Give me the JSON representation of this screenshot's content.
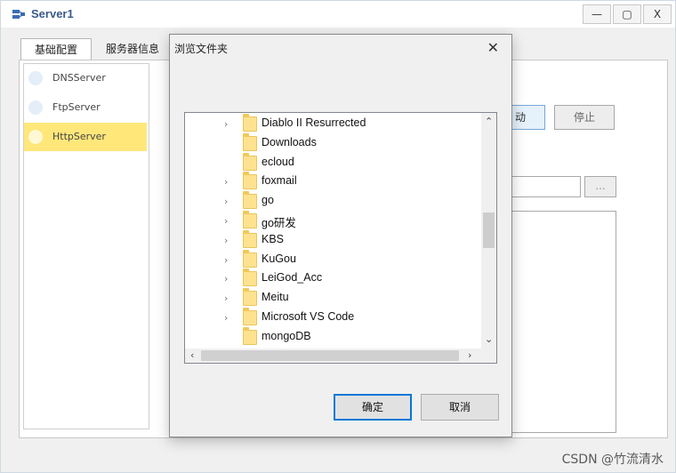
{
  "app": {
    "title": "Server1",
    "minimize": "—",
    "maximize": "▢",
    "close": "X"
  },
  "tabs": [
    "基础配置",
    "服务器信息"
  ],
  "services": [
    "DNSServer",
    "FtpServer",
    "HttpServer"
  ],
  "background_buttons": {
    "start_partial": "动",
    "stop": "停止",
    "browse": "..."
  },
  "dialog": {
    "title": "浏览文件夹",
    "close": "✕",
    "folders": [
      {
        "name": "Diablo II Resurrected",
        "expandable": true
      },
      {
        "name": "Downloads",
        "expandable": false
      },
      {
        "name": "ecloud",
        "expandable": false
      },
      {
        "name": "foxmail",
        "expandable": true
      },
      {
        "name": "go",
        "expandable": true
      },
      {
        "name": "go研发",
        "expandable": true
      },
      {
        "name": "KBS",
        "expandable": true
      },
      {
        "name": "KuGou",
        "expandable": true
      },
      {
        "name": "LeiGod_Acc",
        "expandable": true
      },
      {
        "name": "Meitu",
        "expandable": true
      },
      {
        "name": "Microsoft VS Code",
        "expandable": true
      },
      {
        "name": "mongoDB",
        "expandable": false
      }
    ],
    "ok": "确定",
    "cancel": "取消"
  },
  "watermark": "CSDN @竹流清水"
}
